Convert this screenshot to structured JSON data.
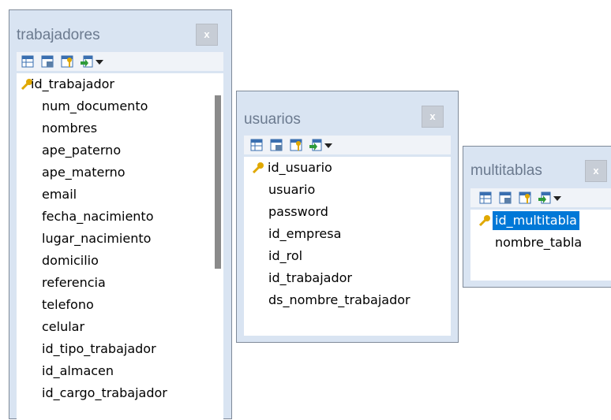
{
  "windows": {
    "trabajadores": {
      "title": "trabajadores",
      "close": "x",
      "fields": [
        "num_documento",
        "nombres",
        "ape_paterno",
        "ape_materno",
        "email",
        "fecha_nacimiento",
        "lugar_nacimiento",
        "domicilio",
        "referencia",
        "telefono",
        "celular",
        "id_tipo_trabajador",
        "id_almacen",
        "id_cargo_trabajador"
      ],
      "key_field": "id_trabajador"
    },
    "usuarios": {
      "title": "usuarios",
      "close": "x",
      "key_field": "id_usuario",
      "fields": [
        "usuario",
        "password",
        "id_empresa",
        "id_rol",
        "id_trabajador",
        "ds_nombre_trabajador"
      ]
    },
    "multitablas": {
      "title": "multitablas",
      "close": "x",
      "key_field": "id_multitabla",
      "fields": [
        "nombre_tabla"
      ]
    }
  },
  "toolbar_icons": [
    "table-grid-icon",
    "table-save-icon",
    "table-key-icon",
    "table-export-icon"
  ],
  "colors": {
    "panel": "#d9e4f2",
    "selection": "#0078d7",
    "title_text": "#6b7a8f",
    "key_icon": "#e0a800"
  }
}
